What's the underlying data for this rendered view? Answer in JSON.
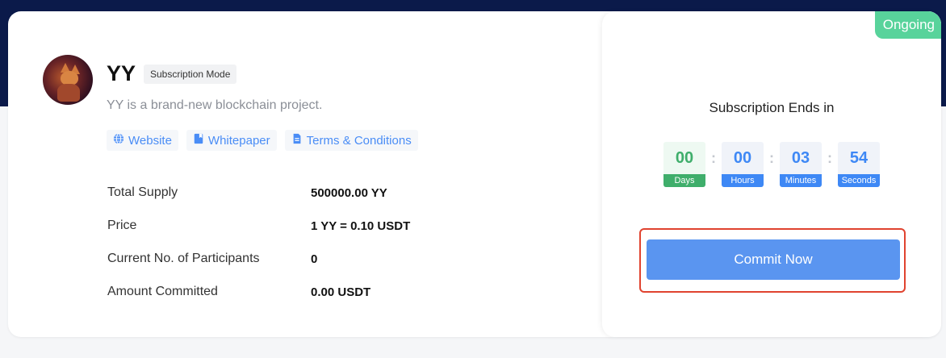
{
  "project": {
    "name": "YY",
    "mode": "Subscription Mode",
    "description": "YY is a brand-new blockchain project.",
    "links": [
      {
        "label": "Website",
        "icon": "globe-icon"
      },
      {
        "label": "Whitepaper",
        "icon": "bookmark-icon"
      },
      {
        "label": "Terms & Conditions",
        "icon": "document-icon"
      }
    ]
  },
  "stats": [
    {
      "label": "Total Supply",
      "value": "500000.00 YY"
    },
    {
      "label": "Price",
      "value": "1 YY = 0.10 USDT"
    },
    {
      "label": "Current No. of Participants",
      "value": "0"
    },
    {
      "label": "Amount Committed",
      "value": "0.00 USDT"
    }
  ],
  "status": {
    "label": "Ongoing",
    "color": "#58d39b"
  },
  "countdown": {
    "title": "Subscription Ends in",
    "units": [
      {
        "value": "00",
        "label": "Days"
      },
      {
        "value": "00",
        "label": "Hours"
      },
      {
        "value": "03",
        "label": "Minutes"
      },
      {
        "value": "54",
        "label": "Seconds"
      }
    ]
  },
  "action": {
    "commit_label": "Commit Now"
  },
  "colors": {
    "accent": "#5a95f0",
    "link": "#4a8df6",
    "highlight_border": "#e0432f",
    "header_band": "#0b1a4a"
  }
}
